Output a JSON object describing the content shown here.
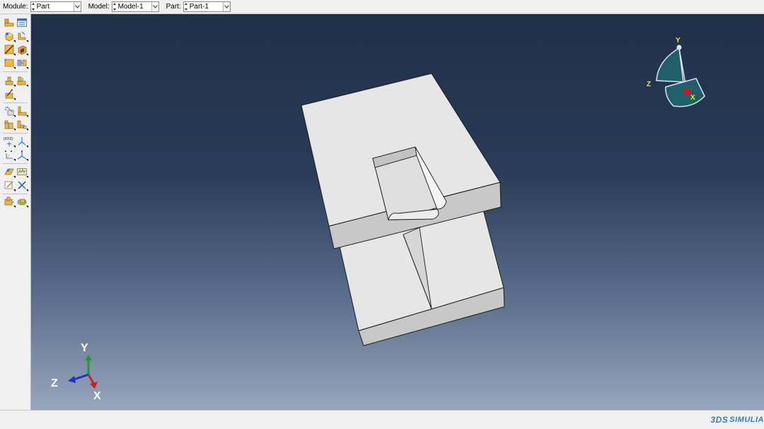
{
  "context_bar": {
    "module_label": "Module:",
    "module_value": "Part",
    "model_label": "Model:",
    "model_value": "Model-1",
    "part_label": "Part:",
    "part_value": "Part-1"
  },
  "toolbox": {
    "groups": [
      [
        "create-part-icon",
        "part-manager-icon"
      ],
      [
        "create-solid-extrude-icon",
        "create-shell-icon"
      ],
      [
        "create-cut-icon",
        "create-wire-icon"
      ],
      [
        "create-fillet-icon",
        "create-partition-icon"
      ],
      [
        "create-datum-icon",
        "create-datum-plane-icon"
      ],
      [
        "edit-feature-icon"
      ],
      [
        "query-icon",
        "repair-geometry-icon"
      ],
      [
        "virtual-topology-icon",
        "create-set-icon"
      ],
      [
        "datum-point-xyz-icon",
        "datum-axis-icon"
      ],
      [
        "datum-csys-icon",
        "datum-csys-3point-icon"
      ],
      [
        "edit-sketch-icon",
        "create-skin-icon"
      ],
      [
        "feature-manipulation-icon",
        "repair-tools-icon"
      ],
      [
        "create-lofted-icon",
        "create-swept-icon"
      ]
    ],
    "tool_labels": {
      "datum_point_xyz": "(XYZ)"
    }
  },
  "viewport": {
    "triad": {
      "x": "X",
      "y": "Y",
      "z": "Z"
    },
    "view_cube": {
      "x": "X",
      "y": "Y",
      "z": "Z"
    },
    "colors": {
      "background_top": "#1f3049",
      "background_bottom": "#97a6bb",
      "part_top_face": "#e6e6e6",
      "part_side_face": "#c8c8c8",
      "triad_x": "#cc1f1f",
      "triad_y": "#1f9c2c",
      "triad_z": "#1f33c8",
      "view_cube_fill": "#1f5f6a"
    }
  },
  "status_bar": {
    "brand": "SIMULIA",
    "brand_logo": "3DS"
  }
}
